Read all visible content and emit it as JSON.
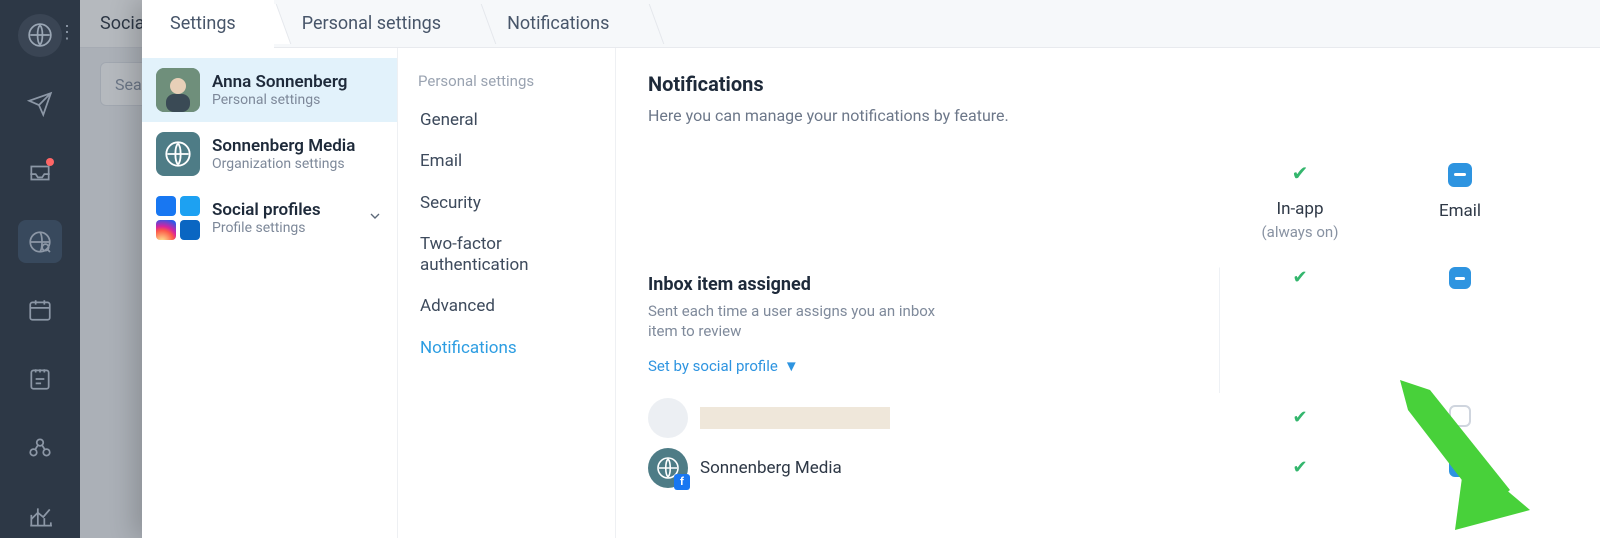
{
  "bg": {
    "header": "Social",
    "search_placeholder": "Sea"
  },
  "breadcrumbs": [
    "Settings",
    "Personal settings",
    "Notifications"
  ],
  "groups": [
    {
      "title": "Anna Sonnenberg",
      "sub": "Personal settings",
      "active": true
    },
    {
      "title": "Sonnenberg Media",
      "sub": "Organization settings"
    },
    {
      "title": "Social profiles",
      "sub": "Profile settings",
      "expandable": true
    }
  ],
  "subnav": {
    "heading": "Personal settings",
    "items": [
      "General",
      "Email",
      "Security",
      "Two-factor authentication",
      "Advanced",
      "Notifications"
    ],
    "active": "Notifications"
  },
  "main": {
    "title": "Notifications",
    "desc": "Here you can manage your notifications by feature.",
    "columns": {
      "inapp_label": "In-app",
      "inapp_sub": "(always on)",
      "email_label": "Email"
    },
    "section": {
      "title": "Inbox item assigned",
      "desc": "Sent each time a user assigns you an inbox item to review",
      "link": "Set by social profile"
    },
    "profiles": {
      "row2_name": "Sonnenberg Media"
    }
  }
}
